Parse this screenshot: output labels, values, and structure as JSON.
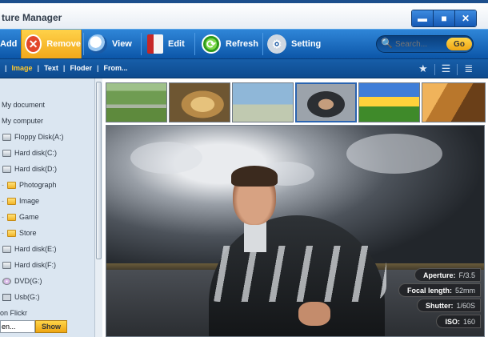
{
  "window": {
    "title": "ture Manager",
    "controls": {
      "minimize": "▬",
      "maximize": "■",
      "close": "✕"
    }
  },
  "toolbar": {
    "add_label": "Add",
    "remove_label": "Remove",
    "view_label": "View",
    "edit_label": "Edit",
    "refresh_label": "Refresh",
    "setting_label": "Setting",
    "search_placeholder": "Search...",
    "go_label": "Go"
  },
  "filterbar": {
    "items": [
      "Image",
      "Text",
      "Floder",
      "From..."
    ],
    "active": "Image"
  },
  "sidebar": {
    "my_document": "My document",
    "my_computer": "My computer",
    "floppy": "Floppy Disk(A:)",
    "hdd_c": "Hard disk(C:)",
    "hdd_d": "Hard disk(D:)",
    "folder_photograph": "Photograph",
    "folder_image": "Image",
    "folder_game": "Game",
    "folder_store": "Store",
    "hdd_e": "Hard disk(E:)",
    "hdd_f": "Hard disk(F:)",
    "dvd": "DVD(G:)",
    "usb": "Usb(G:)",
    "on_flickr": "on Flickr",
    "flickr_input_value": "en...",
    "show_label": "Show"
  },
  "photo_info": {
    "aperture_label": "Aperture:",
    "aperture_value": "F/3.5",
    "focal_label": "Focal length:",
    "focal_value": "52mm",
    "shutter_label": "Shutter:",
    "shutter_value": "1/60S",
    "iso_label": "ISO:",
    "iso_value": "160"
  },
  "colors": {
    "toolbar_blue": "#1565c0",
    "accent_yellow": "#f2a81a",
    "active_filter": "#ffc92d",
    "sidebar_bg": "#dbe6f1"
  }
}
